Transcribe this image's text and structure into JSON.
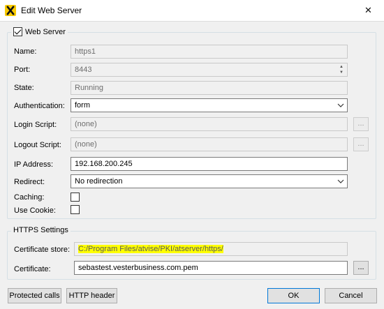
{
  "window": {
    "title": "Edit Web Server",
    "app_icon": "x-logo-icon",
    "close_glyph": "✕"
  },
  "web_server_group": {
    "legend": "Web Server",
    "enabled": true,
    "name_label": "Name:",
    "name_value": "https1",
    "port_label": "Port:",
    "port_value": "8443",
    "state_label": "State:",
    "state_value": "Running",
    "auth_label": "Authentication:",
    "auth_value": "form",
    "login_script_label": "Login Script:",
    "login_script_value": "(none)",
    "logout_script_label": "Logout Script:",
    "logout_script_value": "(none)",
    "ip_label": "IP Address:",
    "ip_value": "192.168.200.245",
    "redirect_label": "Redirect:",
    "redirect_value": "No redirection",
    "caching_label": "Caching:",
    "caching_checked": false,
    "use_cookie_label": "Use Cookie:",
    "use_cookie_checked": false,
    "browse_label": "..."
  },
  "https_group": {
    "legend": "HTTPS Settings",
    "cert_store_label": "Certificate store:",
    "cert_store_value": "C:/Program Files/atvise/PKI/atserver/https/",
    "certificate_label": "Certificate:",
    "certificate_value": "sebastest.vesterbusiness.com.pem",
    "browse_label": "..."
  },
  "footer": {
    "protected_calls": "Protected calls",
    "http_header": "HTTP header",
    "ok": "OK",
    "cancel": "Cancel"
  },
  "colors": {
    "accent": "#0078d7",
    "highlight": "#ffff00",
    "logo": "#f7c900"
  }
}
